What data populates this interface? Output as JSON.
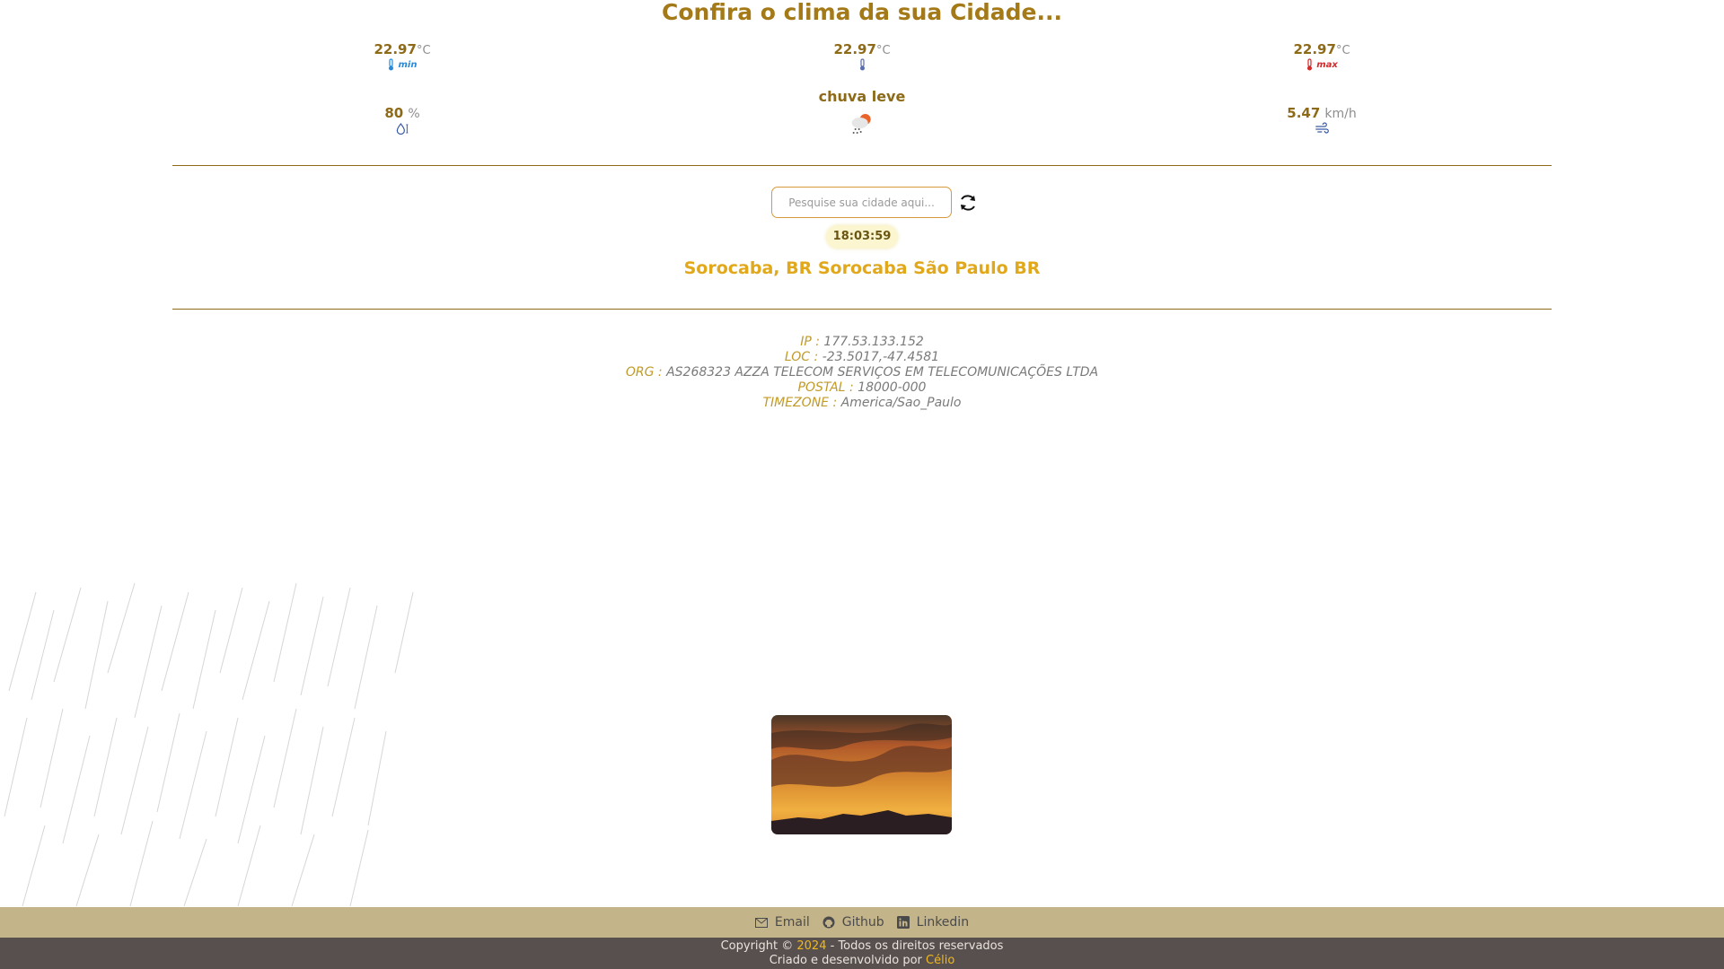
{
  "header": {
    "title": "Confira o clima da sua Cidade..."
  },
  "weather": {
    "temp_min": {
      "value": "22.97",
      "unit": "°C",
      "tag": "min"
    },
    "temp_current": {
      "value": "22.97",
      "unit": "°C"
    },
    "temp_max": {
      "value": "22.97",
      "unit": "°C",
      "tag": "max"
    },
    "humidity": {
      "value": "80",
      "unit": "%"
    },
    "description": "chuva leve",
    "wind": {
      "value": "5.47",
      "unit": "km/h"
    }
  },
  "search": {
    "placeholder": "Pesquise sua cidade aqui..."
  },
  "clock": "18:03:59",
  "location": "Sorocaba, BR Sorocaba São Paulo BR",
  "ip_info": [
    {
      "label": "IP :",
      "value": "177.53.133.152"
    },
    {
      "label": "LOC :",
      "value": "-23.5017,-47.4581"
    },
    {
      "label": "ORG :",
      "value": "AS268323 AZZA TELECOM SERVIÇOS EM TELECOMUNICAÇÕES LTDA"
    },
    {
      "label": "POSTAL :",
      "value": "18000-000"
    },
    {
      "label": "TIMEZONE :",
      "value": "America/Sao_Paulo"
    }
  ],
  "footer": {
    "links": {
      "email": "Email",
      "github": "Github",
      "linkedin": "Linkedin"
    },
    "copyright_prefix": "Copyright ©",
    "year": "2024",
    "copyright_suffix": "- Todos os direitos reservados",
    "credit_prefix": "Criado e desenvolvido por",
    "author": "Célio"
  },
  "colors": {
    "accent": "#a47a18",
    "location": "#e0a81a",
    "footer_top": "#c4b48a",
    "footer_bottom": "#58504f"
  }
}
